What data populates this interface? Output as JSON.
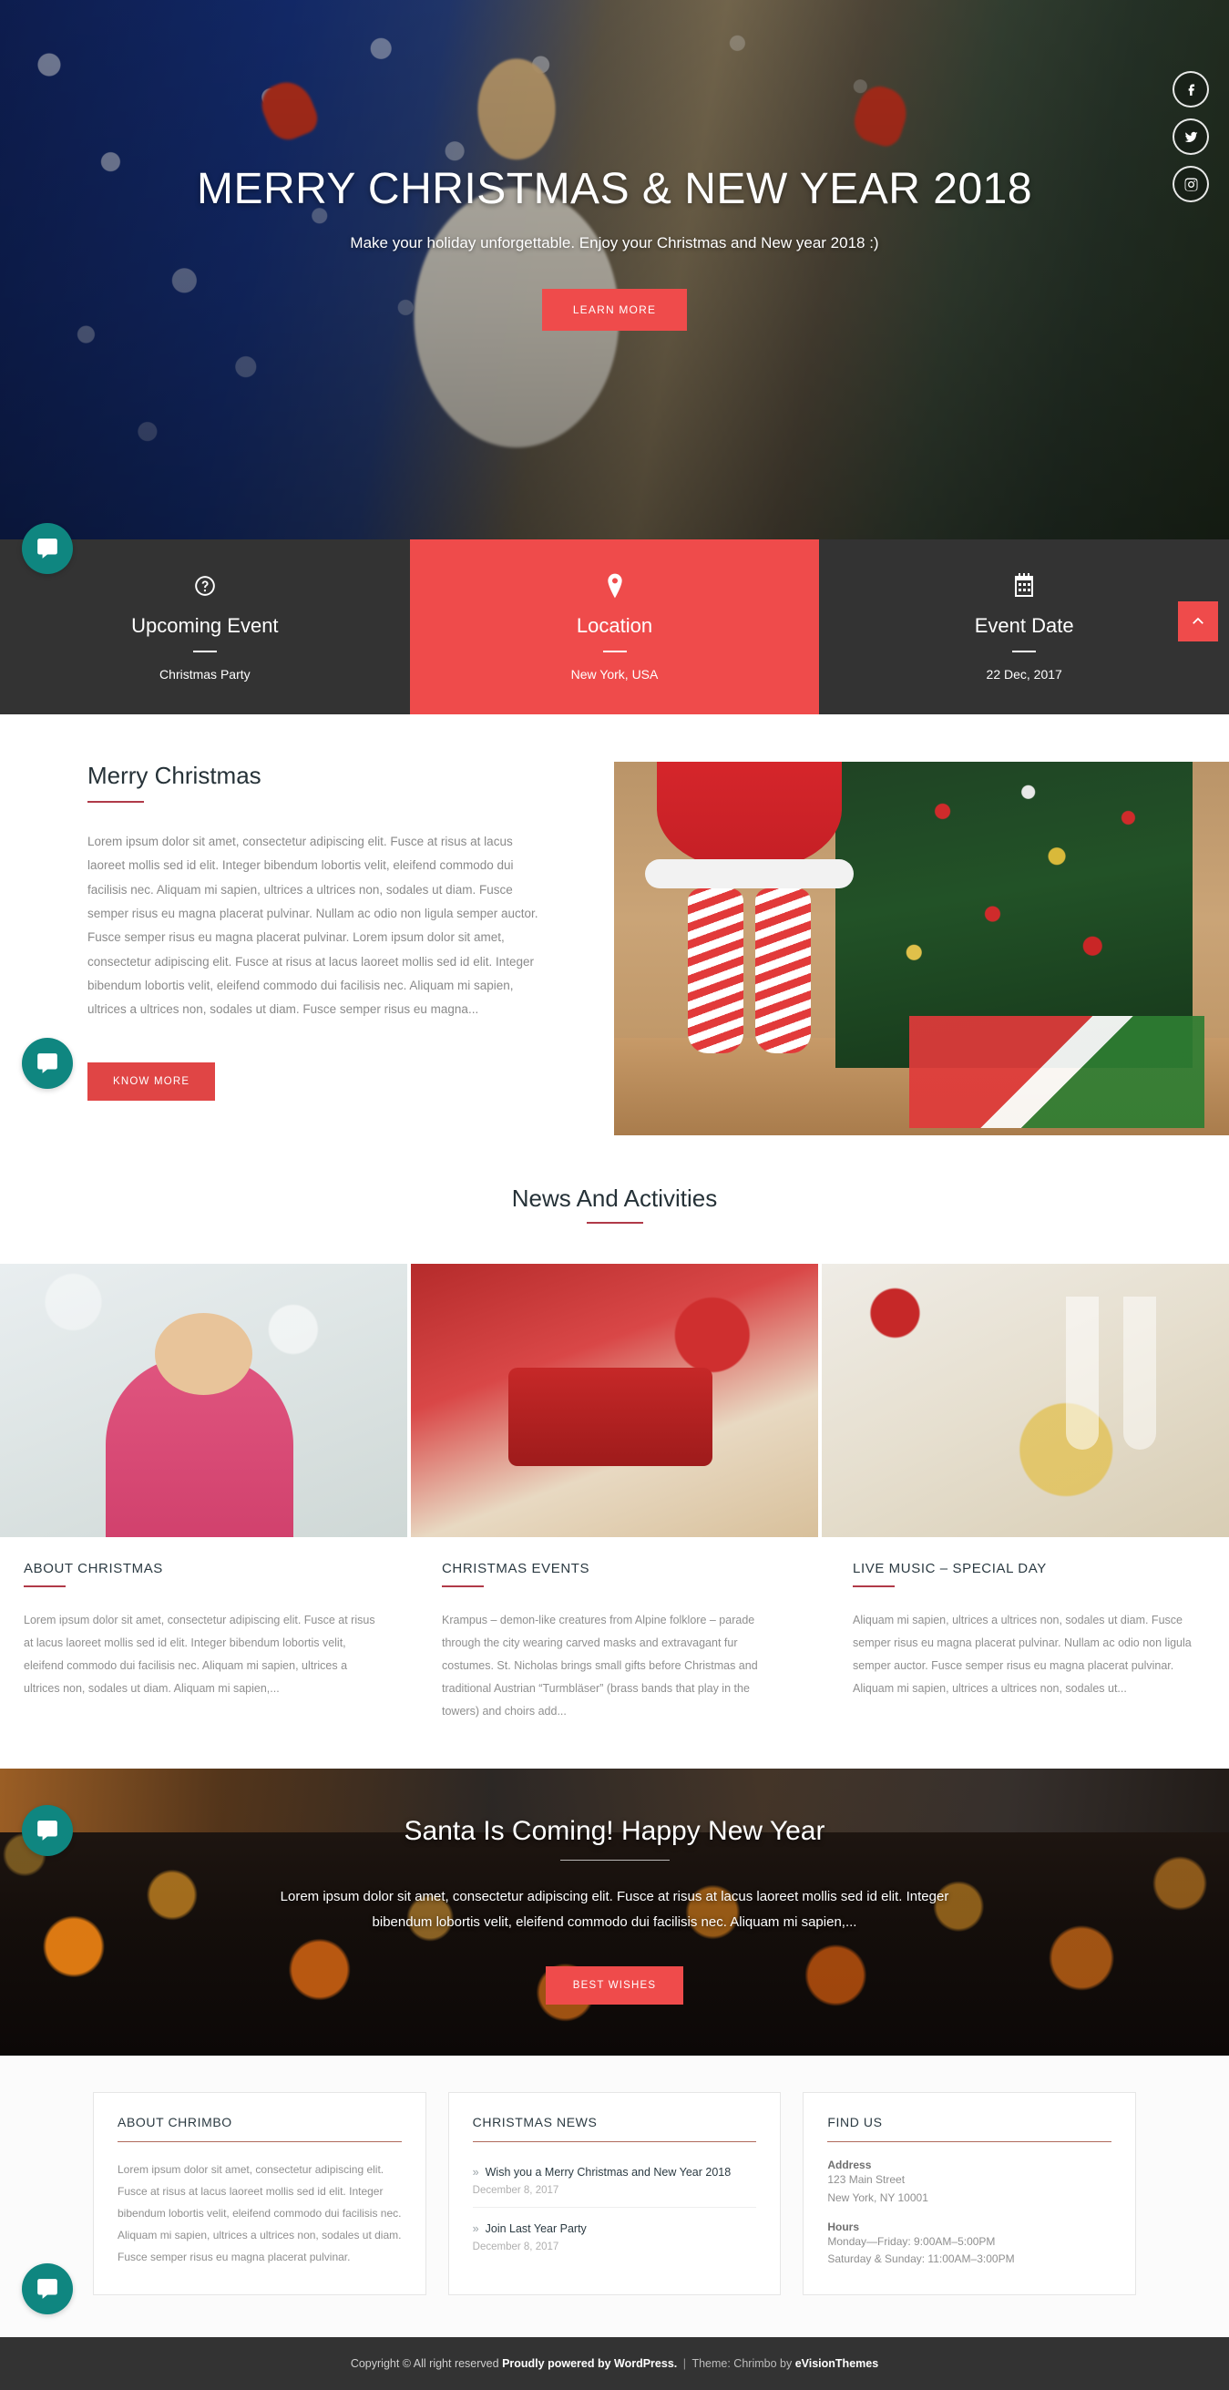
{
  "hero": {
    "title": "MERRY CHRISTMAS & NEW YEAR 2018",
    "subtitle": "Make your holiday unforgettable. Enjoy your Christmas and New year 2018 :)",
    "button": "LEARN MORE",
    "social": [
      {
        "name": "facebook-icon",
        "label": "Facebook"
      },
      {
        "name": "twitter-icon",
        "label": "Twitter"
      },
      {
        "name": "instagram-icon",
        "label": "Instagram"
      }
    ]
  },
  "infobar": {
    "columns": [
      {
        "icon": "question-circle-icon",
        "title": "Upcoming Event",
        "value": "Christmas Party",
        "active": false
      },
      {
        "icon": "map-pin-icon",
        "title": "Location",
        "value": "New York, USA",
        "active": true
      },
      {
        "icon": "calendar-icon",
        "title": "Event Date",
        "value": "22 Dec, 2017",
        "active": false
      }
    ],
    "scroll_top_label": "Back to top"
  },
  "about": {
    "title": "Merry Christmas",
    "text": "Lorem ipsum dolor sit amet, consectetur adipiscing elit. Fusce at risus at lacus laoreet mollis sed id elit. Integer bibendum lobortis velit, eleifend commodo dui facilisis nec. Aliquam mi sapien, ultrices a ultrices non, sodales ut diam. Fusce semper risus eu magna placerat pulvinar. Nullam ac odio non ligula semper auctor. Fusce semper risus eu magna placerat pulvinar. Lorem ipsum dolor sit amet, consectetur adipiscing elit. Fusce at risus at lacus laoreet mollis sed id elit. Integer bibendum lobortis velit, eleifend commodo dui facilisis nec. Aliquam mi sapien, ultrices a ultrices non, sodales ut diam. Fusce semper risus eu magna...",
    "button": "KNOW MORE"
  },
  "news": {
    "heading": "News And Activities",
    "cards": [
      {
        "title": "ABOUT CHRISTMAS",
        "text": "Lorem ipsum dolor sit amet, consectetur adipiscing elit. Fusce at risus at lacus laoreet mollis sed id elit. Integer bibendum lobortis velit, eleifend commodo dui facilisis nec. Aliquam mi sapien, ultrices a ultrices non, sodales ut diam. Aliquam mi sapien,..."
      },
      {
        "title": "CHRISTMAS EVENTS",
        "text": "Krampus – demon-like creatures from Alpine folklore – parade through the city wearing carved masks and extravagant fur costumes. St. Nicholas brings small gifts before Christmas and traditional Austrian “Turmbläser” (brass bands that play in the towers) and choirs add..."
      },
      {
        "title": "LIVE MUSIC – SPECIAL DAY",
        "text": "Aliquam mi sapien, ultrices a ultrices non, sodales ut diam. Fusce semper risus eu magna placerat pulvinar. Nullam ac odio non ligula semper auctor. Fusce semper risus eu magna placerat pulvinar. Aliquam mi sapien, ultrices a ultrices non, sodales ut..."
      }
    ]
  },
  "cta": {
    "title": "Santa Is Coming! Happy New Year",
    "text": "Lorem ipsum dolor sit amet, consectetur adipiscing elit. Fusce at risus at lacus laoreet mollis sed id elit. Integer bibendum lobortis velit, eleifend commodo dui facilisis nec. Aliquam mi sapien,...",
    "button": "BEST WISHES"
  },
  "footer": {
    "about": {
      "title": "ABOUT CHRIMBO",
      "text": "Lorem ipsum dolor sit amet, consectetur adipiscing elit. Fusce at risus at lacus laoreet mollis sed id elit. Integer bibendum lobortis velit, eleifend commodo dui facilisis nec. Aliquam mi sapien, ultrices a ultrices non, sodales ut diam. Fusce semper risus eu magna placerat pulvinar."
    },
    "news": {
      "title": "CHRISTMAS NEWS",
      "items": [
        {
          "link": "Wish you a Merry Christmas and New Year 2018",
          "date": "December 8, 2017"
        },
        {
          "link": "Join Last Year Party",
          "date": "December 8, 2017"
        }
      ]
    },
    "find_us": {
      "title": "FIND US",
      "address_label": "Address",
      "address_line1": "123 Main Street",
      "address_line2": "New York, NY 10001",
      "hours_label": "Hours",
      "hours_line1": "Monday—Friday: 9:00AM–5:00PM",
      "hours_line2": "Saturday & Sunday: 11:00AM–3:00PM"
    }
  },
  "copyright": {
    "prefix": "Copyright © All right reserved ",
    "wordpress": "Proudly powered by WordPress.",
    "separator": " | ",
    "theme_prefix": "Theme: Chrimbo by ",
    "theme_author": "eVisionThemes"
  },
  "chat": {
    "label": "Chat widget"
  },
  "colors": {
    "accent_red": "#ef4b4b",
    "dark_bar": "#333333",
    "teal": "#0f8680",
    "rule_red": "#b03a48"
  }
}
